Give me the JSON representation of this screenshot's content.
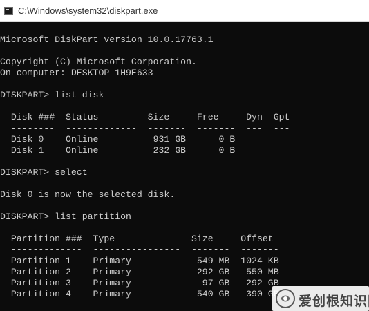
{
  "window": {
    "title": "C:\\Windows\\system32\\diskpart.exe",
    "icon": "console-icon"
  },
  "console": {
    "lines": [
      "",
      "Microsoft DiskPart version 10.0.17763.1",
      "",
      "Copyright (C) Microsoft Corporation.",
      "On computer: DESKTOP-1H9E633",
      "",
      "DISKPART> list disk",
      "",
      "  Disk ###  Status         Size     Free     Dyn  Gpt",
      "  --------  -------------  -------  -------  ---  ---",
      "  Disk 0    Online          931 GB      0 B",
      "  Disk 1    Online          232 GB      0 B",
      "",
      "DISKPART> select",
      "",
      "Disk 0 is now the selected disk.",
      "",
      "DISKPART> list partition",
      "",
      "  Partition ###  Type              Size     Offset",
      "  -------------  ----------------  -------  -------",
      "  Partition 1    Primary            549 MB  1024 KB",
      "  Partition 2    Primary            292 GB   550 MB",
      "  Partition 3    Primary             97 GB   292 GB",
      "  Partition 4    Primary            540 GB   390 GB"
    ]
  },
  "watermark": {
    "text": "爱创根知识网"
  }
}
